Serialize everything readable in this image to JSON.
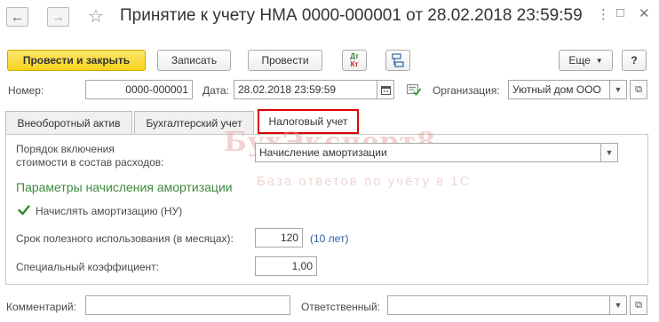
{
  "header": {
    "back_icon": "arrow-left-icon",
    "forward_icon": "arrow-right-icon",
    "favorite_icon": "star-icon",
    "title": "Принятие к учету НМА 0000-000001 от 28.02.2018 23:59:59",
    "menu_icon": "kebab-icon",
    "restore_icon": "restore-icon",
    "close_icon": "close-icon"
  },
  "toolbar": {
    "post_close_label": "Провести и закрыть",
    "save_label": "Записать",
    "post_label": "Провести",
    "dtkt_top": "Дт",
    "dtkt_bottom": "Кт",
    "more_label": "Еще",
    "help_label": "?"
  },
  "form": {
    "number_label": "Номер:",
    "number_value": "0000-000001",
    "date_label": "Дата:",
    "date_value": "28.02.2018 23:59:59",
    "org_label": "Организация:",
    "org_value": "Уютный дом ООО"
  },
  "tabs": [
    {
      "label": "Внеоборотный актив"
    },
    {
      "label": "Бухгалтерский учет"
    },
    {
      "label": "Налоговый учет"
    }
  ],
  "tax": {
    "order_label_line1": "Порядок включения",
    "order_label_line2": "стоимости в состав расходов:",
    "order_value": "Начисление амортизации",
    "section_title": "Параметры начисления амортизации",
    "accrue_checkbox_label": "Начислять амортизацию (НУ)",
    "accrue_checked": true,
    "useful_life_label": "Срок полезного использования (в месяцах):",
    "useful_life_value": "120",
    "useful_life_hint": "(10 лет)",
    "coefficient_label": "Специальный коэффициент:",
    "coefficient_value": "1,00"
  },
  "footer": {
    "comment_label": "Комментарий:",
    "comment_value": "",
    "responsible_label": "Ответственный:",
    "responsible_value": ""
  },
  "watermark": {
    "line1": "БухЭксперт8",
    "line2": "База ответов по учёту в 1С"
  }
}
